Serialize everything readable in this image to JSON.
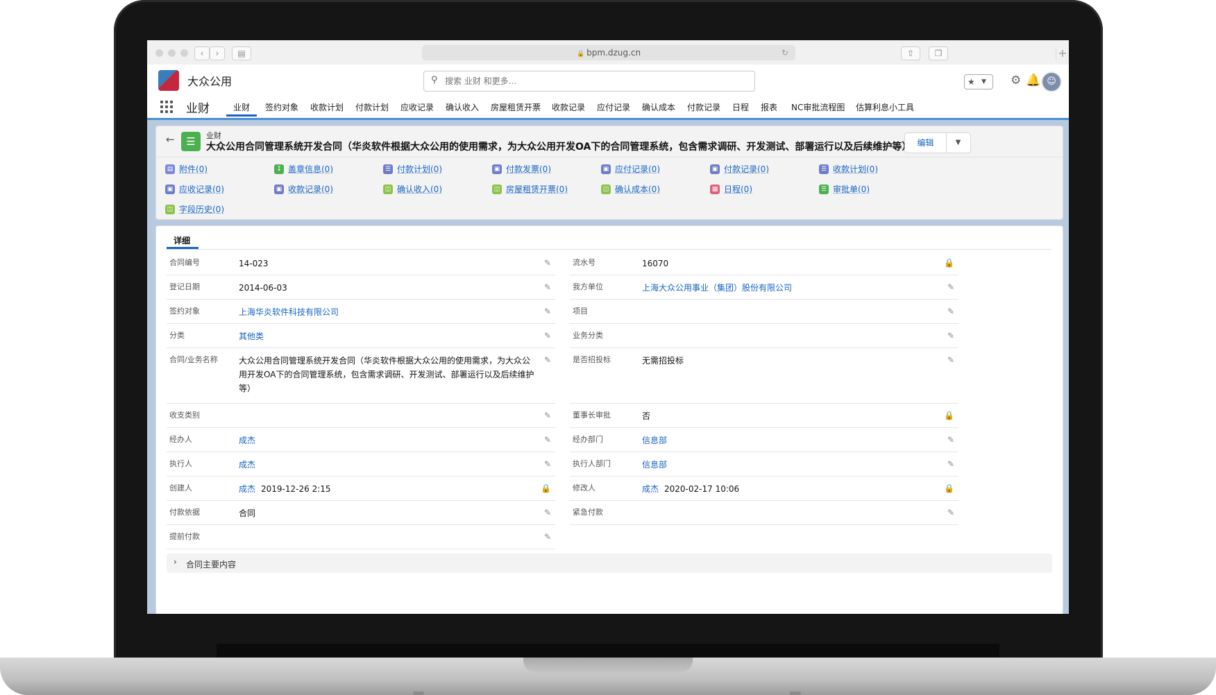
{
  "browser": {
    "url": "bpm.dzug.cn"
  },
  "header": {
    "brand": "大众公用",
    "search_placeholder": "搜索 业财 和更多..."
  },
  "nav": {
    "app_name": "业财",
    "tabs": [
      {
        "label": "业财"
      },
      {
        "label": "签约对象"
      },
      {
        "label": "收款计划"
      },
      {
        "label": "付款计划"
      },
      {
        "label": "应收记录"
      },
      {
        "label": "确认收入"
      },
      {
        "label": "房屋租赁开票"
      },
      {
        "label": "收款记录"
      },
      {
        "label": "应付记录"
      },
      {
        "label": "确认成本"
      },
      {
        "label": "付款记录"
      },
      {
        "label": "日程"
      },
      {
        "label": "报表"
      },
      {
        "label": "NC审批流程图"
      },
      {
        "label": "估算利息小工具"
      }
    ]
  },
  "record": {
    "type": "业财",
    "title": "大众公用合同管理系统开发合同（华炎软件根据大众公用的使用需求，为大众公用开发OA下的合同管理系统，包含需求调研、开发测试、部署运行以及后续维护等）",
    "edit_label": "编辑"
  },
  "related": [
    {
      "label": "附件(0)",
      "color": "#7b86d8"
    },
    {
      "label": "盖章信息(0)",
      "color": "#4caf50"
    },
    {
      "label": "付款计划(0)",
      "color": "#6f7cc7"
    },
    {
      "label": "付款发票(0)",
      "color": "#6f7cc7"
    },
    {
      "label": "应付记录(0)",
      "color": "#6f7cc7"
    },
    {
      "label": "付款记录(0)",
      "color": "#6f7cc7"
    },
    {
      "label": "收款计划(0)",
      "color": "#6f7cc7"
    },
    {
      "label": "应收记录(0)",
      "color": "#6f7cc7"
    },
    {
      "label": "收款记录(0)",
      "color": "#6f7cc7"
    },
    {
      "label": "确认收入(0)",
      "color": "#8bc34a"
    },
    {
      "label": "房屋租赁开票(0)",
      "color": "#8bc34a"
    },
    {
      "label": "确认成本(0)",
      "color": "#8bc34a"
    },
    {
      "label": "日程(0)",
      "color": "#e0607e"
    },
    {
      "label": "审批单(0)",
      "color": "#4caf50"
    },
    {
      "label": "字段历史(0)",
      "color": "#8bc34a"
    }
  ],
  "detail": {
    "tab_label": "详细",
    "left_fields": [
      {
        "label": "合同编号",
        "value": "14-023"
      },
      {
        "label": "登记日期",
        "value": "2014-06-03"
      },
      {
        "label": "签约对象",
        "value": "上海华炎软件科技有限公司"
      },
      {
        "label": "分类",
        "value": "其他类"
      },
      {
        "label": "合同/业务名称",
        "value": "大众公用合同管理系统开发合同（华炎软件根据大众公用的使用需求，为大众公用开发OA下的合同管理系统，包含需求调研、开发测试、部署运行以及后续维护等）"
      },
      {
        "label": "收支类别",
        "value": ""
      },
      {
        "label": "经办人",
        "value": "成杰"
      },
      {
        "label": "执行人",
        "value": "成杰"
      },
      {
        "label": "创建人",
        "user": "成杰",
        "value": "2019-12-26 2:15"
      },
      {
        "label": "付款依据",
        "value": "合同"
      },
      {
        "label": "提前付款",
        "value": ""
      }
    ],
    "right_fields": [
      {
        "label": "流水号",
        "value": "16070"
      },
      {
        "label": "我方单位",
        "value": "上海大众公用事业（集团）股份有限公司"
      },
      {
        "label": "项目",
        "value": ""
      },
      {
        "label": "业务分类",
        "value": ""
      },
      {
        "label": "是否招投标",
        "value": "无需招投标"
      },
      {
        "label": "董事长审批",
        "value": "否"
      },
      {
        "label": "经办部门",
        "value": "信息部"
      },
      {
        "label": "执行人部门",
        "value": "信息部"
      },
      {
        "label": "修改人",
        "user": "成杰",
        "value": "2020-02-17 10:06"
      },
      {
        "label": "紧急付款",
        "value": ""
      }
    ],
    "section_label": "合同主要内容"
  }
}
